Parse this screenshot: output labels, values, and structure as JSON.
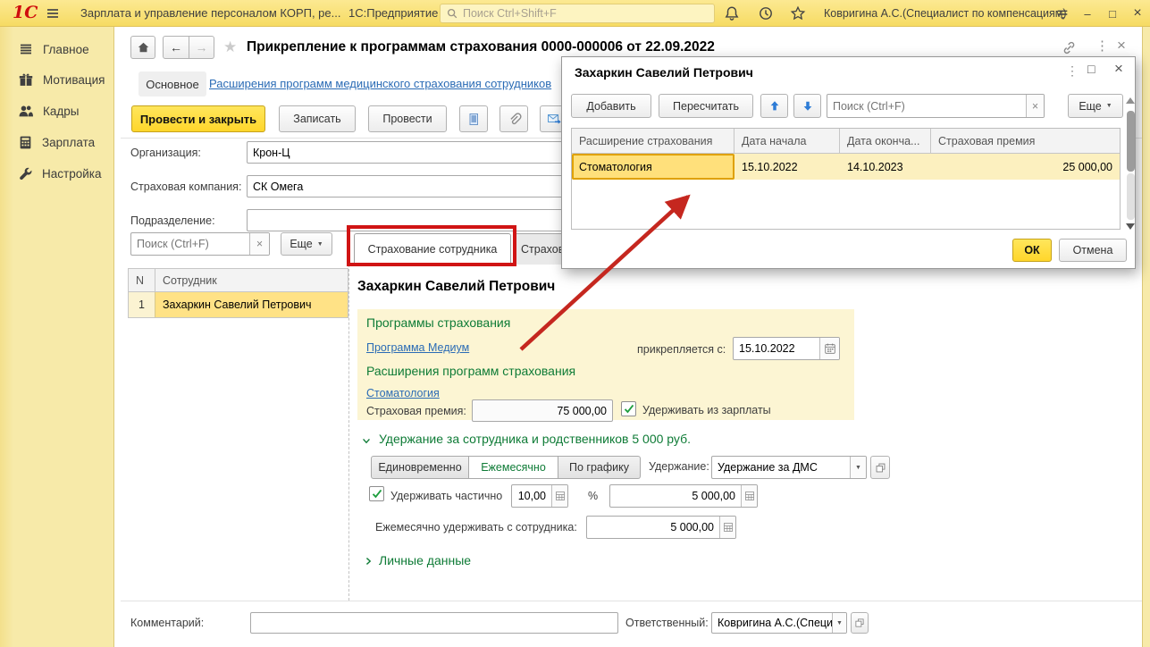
{
  "titlebar": {
    "logo": "1С",
    "app_title": "Зарплата и управление персоналом КОРП, ре...",
    "product": "1С:Предприятие",
    "search_placeholder": "Поиск Ctrl+Shift+F",
    "user": "Ковригина А.С.(Специалист по компенсациям)"
  },
  "sidebar": {
    "items": [
      {
        "label": "Главное"
      },
      {
        "label": "Мотивация"
      },
      {
        "label": "Кадры"
      },
      {
        "label": "Зарплата"
      },
      {
        "label": "Настройка"
      }
    ]
  },
  "header": {
    "title": "Прикрепление к программам страхования 0000-000006 от 22.09.2022"
  },
  "nav": {
    "tab_main": "Основное",
    "tab_link": "Расширения программ медицинского страхования сотрудников"
  },
  "toolbar": {
    "post_and_close": "Провести и закрыть",
    "save": "Записать",
    "post": "Провести"
  },
  "form": {
    "org_label": "Организация:",
    "org_value": "Крон-Ц",
    "insurer_label": "Страховая компания:",
    "insurer_value": "СК Омега",
    "department_label": "Подразделение:",
    "department_value": "",
    "search_placeholder": "Поиск (Ctrl+F)",
    "more": "Еще",
    "tab_employee": "Страхование сотрудника",
    "tab_relatives": "Страхова"
  },
  "employee_table": {
    "col_n": "N",
    "col_name": "Сотрудник",
    "rows": [
      {
        "n": "1",
        "name": "Захаркин Савелий Петрович"
      }
    ]
  },
  "detail": {
    "heading": "Захаркин Савелий Петрович",
    "programs_title": "Программы страхования",
    "program_link": "Программа Медиум",
    "attached_from_label": "прикрепляется с:",
    "attached_from_value": "15.10.2022",
    "extensions_title": "Расширения программ страхования",
    "extension_link": "Стоматология",
    "premium_label": "Страховая премия:",
    "premium_value": "75 000,00",
    "withhold_from_salary": "Удерживать из зарплаты",
    "deduction_group": "Удержание за сотрудника и родственников 5 000 руб.",
    "mode_once": "Единовременно",
    "mode_monthly": "Ежемесячно",
    "mode_schedule": "По графику",
    "deduction_label": "Удержание:",
    "deduction_value": "Удержание за ДМС",
    "partial_label": "Удерживать частично",
    "partial_percent": "10,00",
    "percent_sign": "%",
    "partial_amount": "5 000,00",
    "monthly_label": "Ежемесячно удерживать с сотрудника:",
    "monthly_amount": "5 000,00",
    "personal_data_group": "Личные данные"
  },
  "footer": {
    "comment_label": "Комментарий:",
    "responsible_label": "Ответственный:",
    "responsible_value": "Ковригина А.С.(Специали"
  },
  "modal": {
    "title": "Захаркин Савелий Петрович",
    "add": "Добавить",
    "recalculate": "Пересчитать",
    "search_placeholder": "Поиск (Ctrl+F)",
    "more": "Еще",
    "table": {
      "col_extension": "Расширение страхования",
      "col_start": "Дата начала",
      "col_end": "Дата оконча...",
      "col_premium": "Страховая премия",
      "rows": [
        {
          "extension": "Стоматология",
          "start": "15.10.2022",
          "end": "14.10.2023",
          "premium": "25 000,00"
        }
      ]
    },
    "ok": "ОК",
    "cancel": "Отмена"
  },
  "icons": {
    "caret": "▼",
    "clear": "×",
    "kebab": "⋮",
    "star": "★",
    "back": "←",
    "forward": "→",
    "minimize": "–",
    "maximize": "□",
    "close": "×"
  },
  "colors": {
    "accent_yellow": "#ffd62b",
    "titlebar": "#f8e07c",
    "sidebar": "#f7eaa9",
    "green": "#0e7b36",
    "link_blue": "#2a6bb5",
    "selection_yellow": "#ffe286",
    "panel_yellow": "#fcf5d3",
    "annotation_red": "#d01414"
  }
}
